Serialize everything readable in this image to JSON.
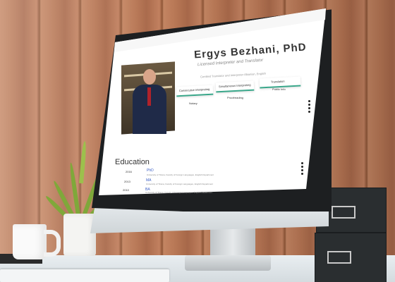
{
  "website": {
    "name": "Ergys Bezhani, PhD",
    "tagline": "Licensed Interpreter and Translator",
    "subtitle": "Certified Translator and Interpreter Albanian, English",
    "buttons": [
      {
        "label": "Consecutive Interpreting"
      },
      {
        "label": "Simultaneous Interpreting"
      },
      {
        "label": "Translation"
      }
    ],
    "links": [
      "Notary",
      "Proofreading",
      "Public Info"
    ],
    "section_title": "Education",
    "education": [
      {
        "year": "2016",
        "degree": "PhD",
        "detail": "University of Tirana, Faculty of Foreign Languages, English Department"
      },
      {
        "year": "2013",
        "degree": "MA",
        "detail": "University of Tirana, Faculty of Foreign Languages, English Department"
      },
      {
        "year": "2010",
        "degree": "BA",
        "detail": "University of Tirana, Faculty of Foreign Languages, English Department"
      }
    ]
  },
  "colors": {
    "accent": "#3aa78a",
    "wood": "#c48562",
    "monitor_bezel": "#1d1f21"
  }
}
